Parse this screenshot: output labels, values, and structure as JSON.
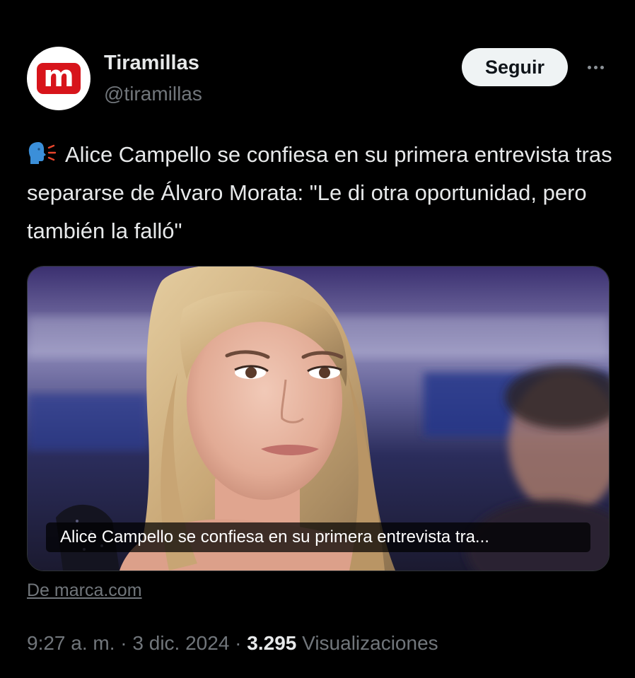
{
  "account": {
    "name": "Tiramillas",
    "handle": "@tiramillas",
    "avatar_letter": "m",
    "avatar_color": "#d7141b"
  },
  "actions": {
    "follow_label": "Seguir",
    "more_icon": "more-horizontal-icon"
  },
  "tweet": {
    "emoji_icon": "speaking-head-icon",
    "text": "Alice Campello se confiesa en su primera entrevista tras separarse de Álvaro Morata: \"Le di otra oportunidad, pero también la falló\""
  },
  "card": {
    "caption": "Alice Campello se confiesa en su primera entrevista tra...",
    "source": "De marca.com"
  },
  "meta": {
    "time": "9:27 a. m.",
    "separator": " · ",
    "date": "3 dic. 2024",
    "views_count": "3.295",
    "views_label": "Visualizaciones"
  },
  "colors": {
    "background": "#000000",
    "text_primary": "#e7e9ea",
    "text_secondary": "#71767b",
    "button_bg": "#eff3f4"
  }
}
